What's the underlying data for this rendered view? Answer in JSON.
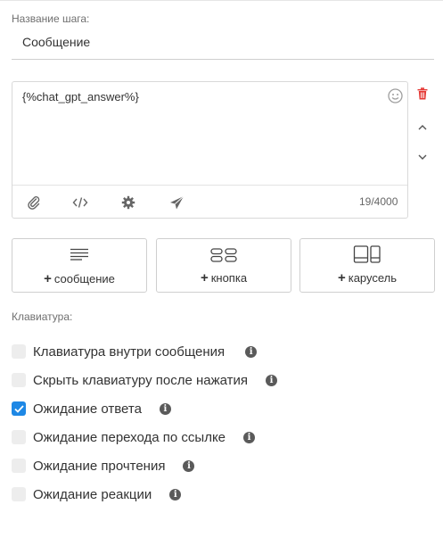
{
  "step": {
    "name_label": "Название шага:",
    "name_value": "Сообщение"
  },
  "message": {
    "text": "{%chat_gpt_answer%}",
    "counter": "19/4000",
    "toolbar_icons": [
      "paperclip-icon",
      "code-icon",
      "gear-icon",
      "send-icon"
    ],
    "side_icons": [
      "emoji-icon",
      "trash-icon",
      "chevron-up-icon",
      "chevron-down-icon"
    ]
  },
  "add_buttons": [
    {
      "plus": "+",
      "label": "сообщение",
      "icon": "text-lines-icon"
    },
    {
      "plus": "+",
      "label": "кнопка",
      "icon": "buttons-icon"
    },
    {
      "plus": "+",
      "label": "карусель",
      "icon": "carousel-icon"
    }
  ],
  "keyboard": {
    "label": "Клавиатура:",
    "options": [
      {
        "label": "Клавиатура внутри сообщения",
        "checked": false
      },
      {
        "label": "Скрыть клавиатуру после нажатия",
        "checked": false
      },
      {
        "label": "Ожидание ответа",
        "checked": true
      },
      {
        "label": "Ожидание перехода по ссылке",
        "checked": false
      },
      {
        "label": "Ожидание прочтения",
        "checked": false
      },
      {
        "label": "Ожидание реакции",
        "checked": false
      }
    ],
    "info_glyph": "i"
  },
  "colors": {
    "accent": "#1e88e5",
    "danger": "#e53935",
    "border": "#d9d9d9"
  }
}
